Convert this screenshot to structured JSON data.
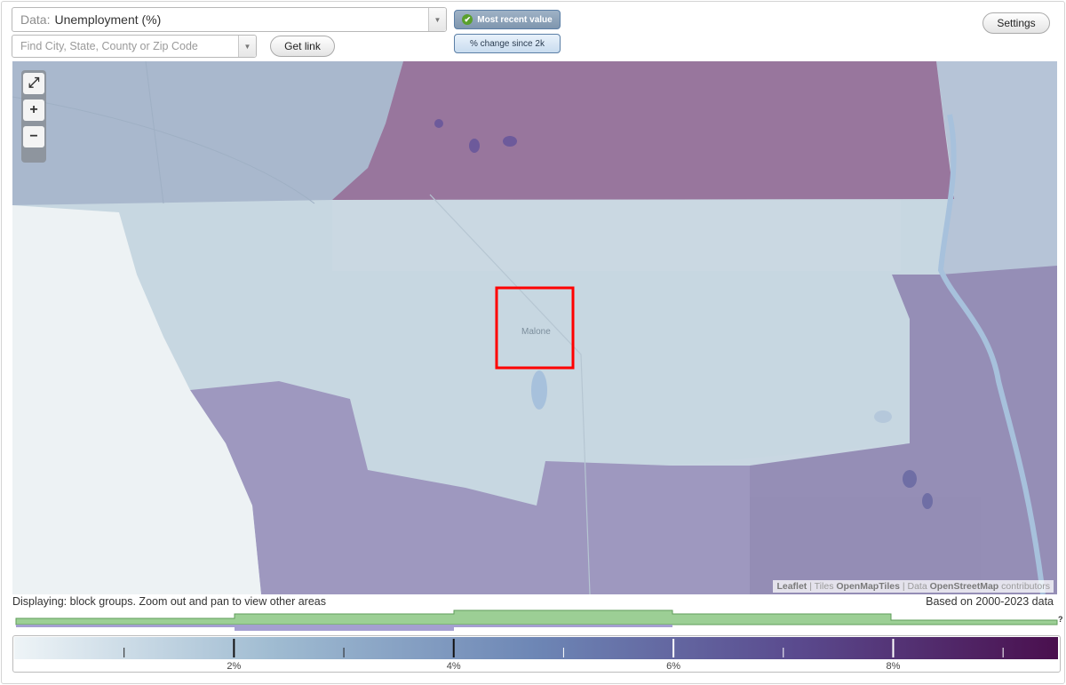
{
  "data_select": {
    "label": "Data:",
    "value": "Unemployment (%)"
  },
  "search": {
    "placeholder": "Find City, State, County or Zip Code"
  },
  "buttons": {
    "get_link": "Get link",
    "settings": "Settings"
  },
  "modes": {
    "recent": "Most recent value",
    "change": "% change since 2k"
  },
  "map": {
    "place_label": "Malone",
    "zoom": {
      "fit": "⤢",
      "in": "+",
      "out": "−"
    },
    "attribution": {
      "leaflet": "Leaflet",
      "tiles_prefix": "| Tiles",
      "tiles": "OpenMapTiles",
      "data_prefix": "| Data",
      "data": "OpenStreetMap",
      "suffix": "contributors"
    }
  },
  "status": {
    "left": "Displaying: block groups. Zoom out and pan to view other areas",
    "right": "Based on 2000-2023 data"
  },
  "legend": {
    "question": "?",
    "ticks": [
      {
        "value": 2,
        "label": "2%"
      },
      {
        "value": 4,
        "label": "4%"
      },
      {
        "value": 6,
        "label": "6%"
      },
      {
        "value": 8,
        "label": "8%"
      }
    ],
    "domain": [
      0,
      9.5
    ],
    "colors": [
      "#eef4f7",
      "#9fbbd1",
      "#6d86b5",
      "#5a4a8e",
      "#4a0f4e"
    ]
  },
  "colors": {
    "selection": "#ff0000",
    "water": "#a7c1dc",
    "hist_green": "#9ccf95",
    "hist_purple": "#a49fd0"
  }
}
